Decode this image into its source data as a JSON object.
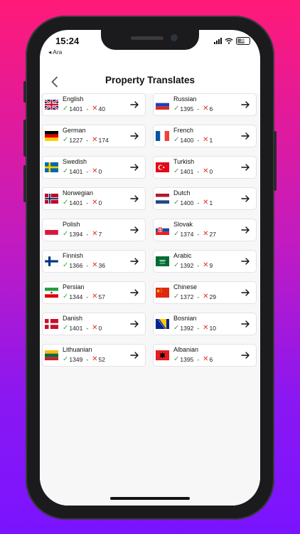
{
  "status": {
    "time": "15:24",
    "back": "◂ Ara",
    "battery": "38"
  },
  "header": {
    "title": "Property Translates"
  },
  "languages": [
    {
      "name": "English",
      "ok": "1401",
      "bad": "40",
      "flag": "uk"
    },
    {
      "name": "Russian",
      "ok": "1395",
      "bad": "6",
      "flag": "ru"
    },
    {
      "name": "German",
      "ok": "1227",
      "bad": "174",
      "flag": "de"
    },
    {
      "name": "French",
      "ok": "1400",
      "bad": "1",
      "flag": "fr"
    },
    {
      "name": "Swedish",
      "ok": "1401",
      "bad": "0",
      "flag": "se"
    },
    {
      "name": "Turkish",
      "ok": "1401",
      "bad": "0",
      "flag": "tr"
    },
    {
      "name": "Norwegian",
      "ok": "1401",
      "bad": "0",
      "flag": "no"
    },
    {
      "name": "Dutch",
      "ok": "1400",
      "bad": "1",
      "flag": "nl"
    },
    {
      "name": "Polish",
      "ok": "1394",
      "bad": "7",
      "flag": "pl"
    },
    {
      "name": "Slovak",
      "ok": "1374",
      "bad": "27",
      "flag": "sk"
    },
    {
      "name": "Finnish",
      "ok": "1366",
      "bad": "36",
      "flag": "fi"
    },
    {
      "name": "Arabic",
      "ok": "1392",
      "bad": "9",
      "flag": "sa"
    },
    {
      "name": "Persian",
      "ok": "1344",
      "bad": "57",
      "flag": "ir"
    },
    {
      "name": "Chinese",
      "ok": "1372",
      "bad": "29",
      "flag": "cn"
    },
    {
      "name": "Danish",
      "ok": "1401",
      "bad": "0",
      "flag": "dk"
    },
    {
      "name": "Bosnian",
      "ok": "1392",
      "bad": "10",
      "flag": "ba"
    },
    {
      "name": "Lithuanian",
      "ok": "1349",
      "bad": "52",
      "flag": "lt"
    },
    {
      "name": "Albanian",
      "ok": "1395",
      "bad": "6",
      "flag": "al"
    }
  ],
  "colors": {
    "ok": "#3cae3f",
    "bad": "#e0342b",
    "background_top": "#ff1a78",
    "background_bottom": "#7a14ff"
  }
}
